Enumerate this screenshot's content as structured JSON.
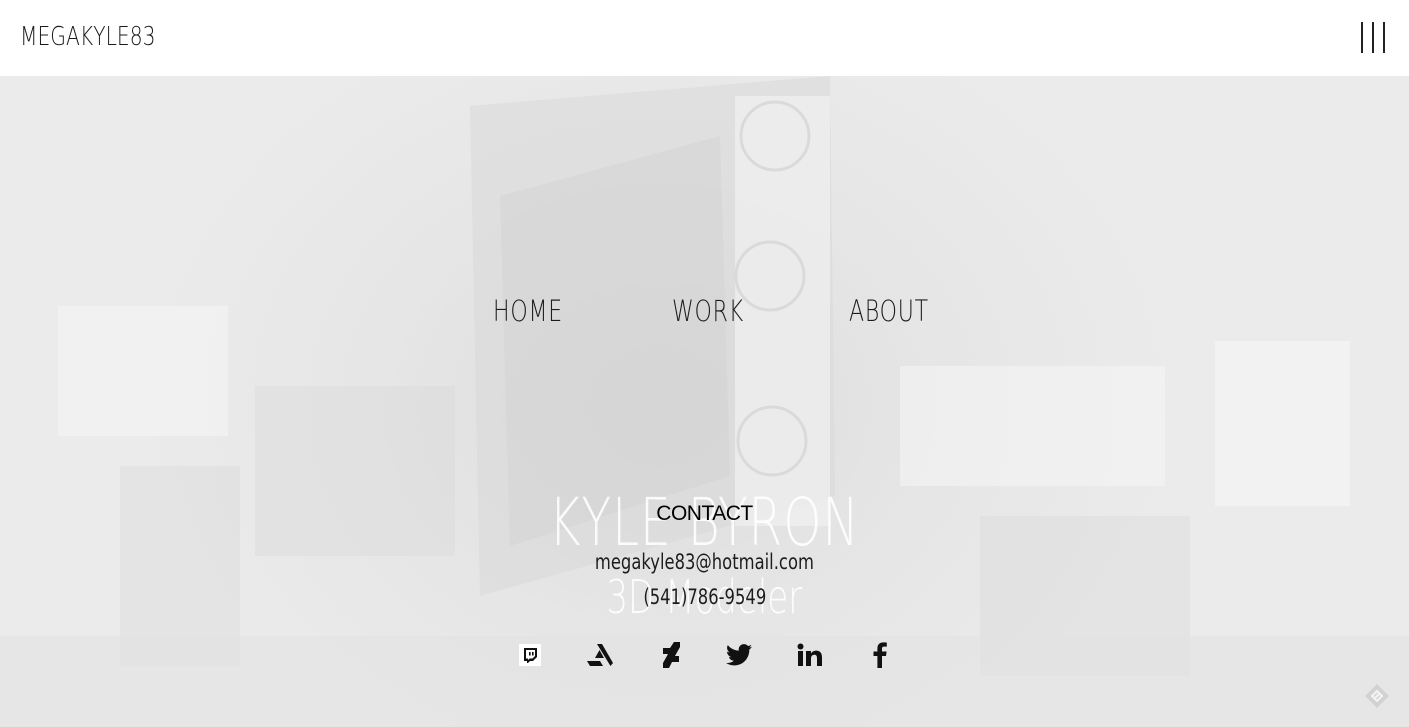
{
  "header": {
    "logo": "MEGAKYLE83",
    "menu_icon": "hamburger-vertical-lines-icon"
  },
  "nav": {
    "items": [
      {
        "label": "HOME"
      },
      {
        "label": "WORK"
      },
      {
        "label": "ABOUT"
      }
    ]
  },
  "hero": {
    "name": "KYLE BYRON",
    "role": "3D Modeler"
  },
  "contact": {
    "title": "CONTACT",
    "email": "megakyle83@hotmail.com",
    "phone": "(541)786-9549"
  },
  "social": [
    {
      "name": "twitch",
      "icon": "twitch-icon"
    },
    {
      "name": "artstation",
      "icon": "artstation-icon"
    },
    {
      "name": "deviantart",
      "icon": "deviantart-icon"
    },
    {
      "name": "twitter",
      "icon": "twitter-icon"
    },
    {
      "name": "linkedin",
      "icon": "linkedin-icon"
    },
    {
      "name": "facebook",
      "icon": "facebook-icon"
    }
  ],
  "colors": {
    "header_bg": "#ffffff",
    "page_bg": "#e9e9e9",
    "text": "#111111",
    "icon": "#111111"
  }
}
